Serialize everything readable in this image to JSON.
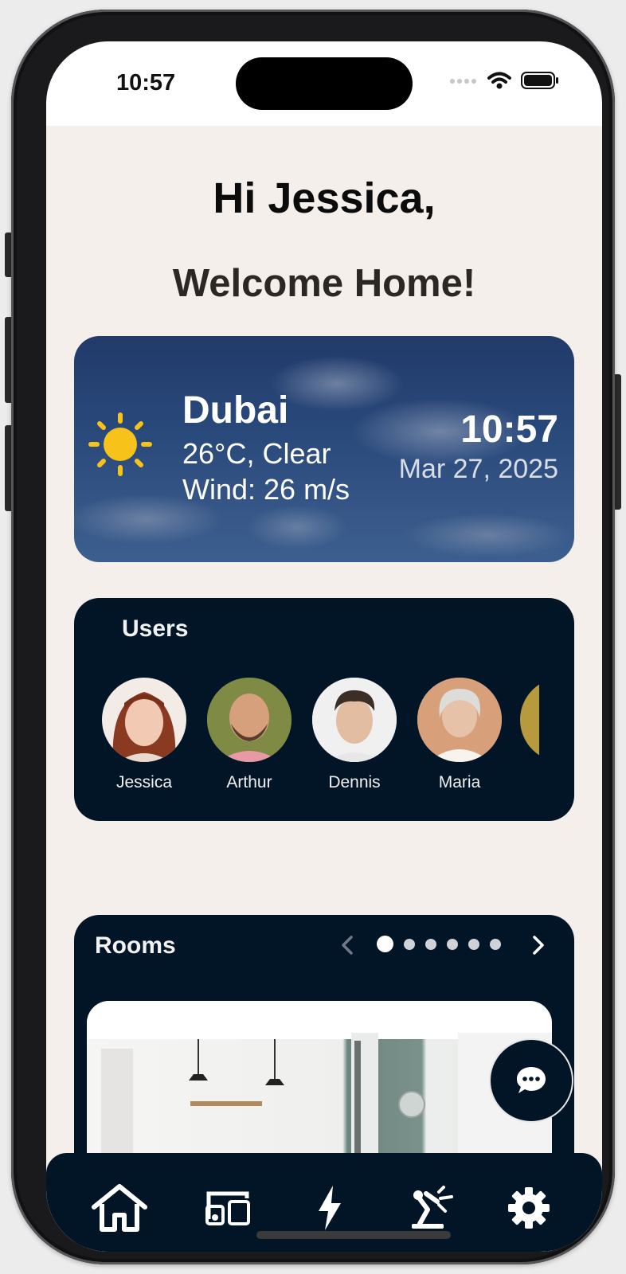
{
  "status_bar": {
    "time": "10:57"
  },
  "greeting": {
    "line1": "Hi Jessica,",
    "line2": "Welcome Home!"
  },
  "weather": {
    "icon": "sun-icon",
    "city": "Dubai",
    "condition": "26°C, Clear",
    "wind": "Wind: 26 m/s",
    "time": "10:57",
    "date": "Mar 27, 2025"
  },
  "users": {
    "title": "Users",
    "items": [
      {
        "name": "Jessica"
      },
      {
        "name": "Arthur"
      },
      {
        "name": "Dennis"
      },
      {
        "name": "Maria"
      }
    ]
  },
  "rooms": {
    "title": "Rooms",
    "page_count": 6,
    "active_page": 1
  },
  "bottom_nav": {
    "items": [
      {
        "icon": "home-icon"
      },
      {
        "icon": "devices-icon"
      },
      {
        "icon": "energy-icon"
      },
      {
        "icon": "automation-icon"
      },
      {
        "icon": "settings-icon"
      }
    ]
  },
  "colors": {
    "background": "#f4efea",
    "card_dark": "#021527",
    "sun": "#f7c31a"
  }
}
